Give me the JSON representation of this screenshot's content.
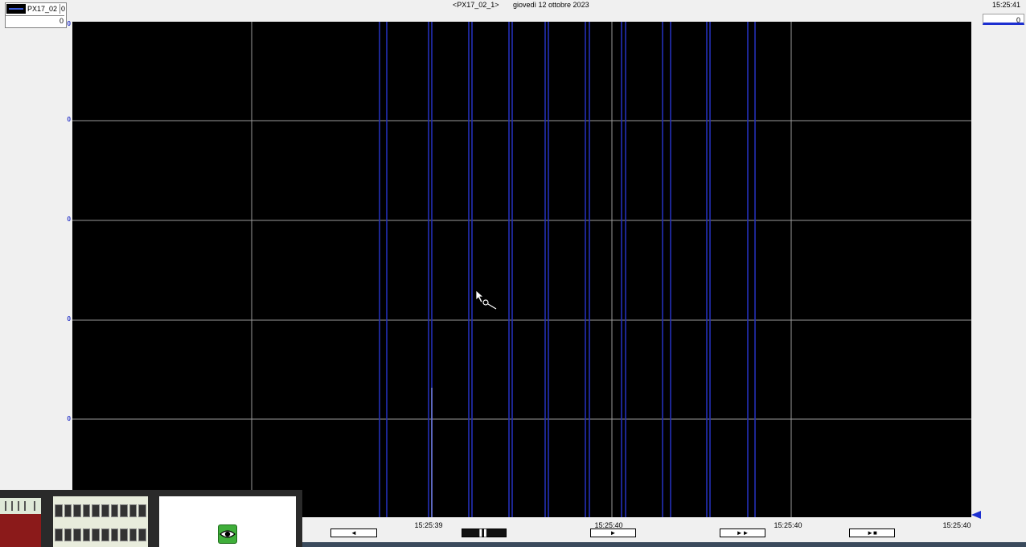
{
  "header": {
    "legend": {
      "name": "PX17_02",
      "value1": "0",
      "value2": "0"
    },
    "source": "<PX17_02_1>",
    "date": "giovedì 12 ottobre 2023",
    "time": "15:25:41",
    "right_value": "0"
  },
  "y_ticks": [
    "0",
    "0",
    "0",
    "0",
    "0"
  ],
  "x_ticks": [
    "15:25:39",
    "15:25:40",
    "15:25:40",
    "15:25:40"
  ],
  "controls": {
    "rewind_glyph": "◄",
    "pause_glyph": "▌▌",
    "play_glyph": "►",
    "fast_forward_glyph": "►►",
    "play_stop_glyph": "►■"
  },
  "colors": {
    "plot_background": "#000000",
    "grid": "#9a9a9a",
    "trace": "#2430b8",
    "accent": "#1c2fd0"
  }
}
